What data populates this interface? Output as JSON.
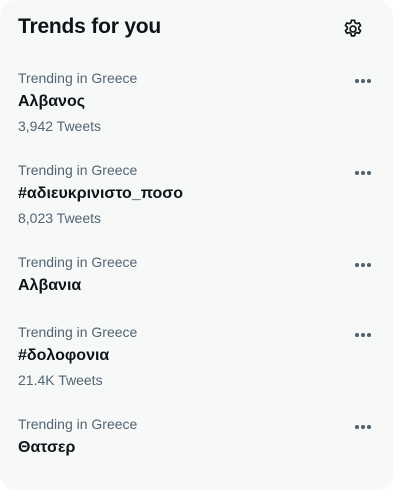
{
  "header": {
    "title": "Trends for you",
    "settings_icon": "gear-icon"
  },
  "trends": [
    {
      "context": "Trending in Greece",
      "name": "Αλβανος",
      "count": "3,942 Tweets",
      "more_icon": "more-horizontal-icon"
    },
    {
      "context": "Trending in Greece",
      "name": "#αδιευκρινιστο_ποσο",
      "count": "8,023 Tweets",
      "more_icon": "more-horizontal-icon"
    },
    {
      "context": "Trending in Greece",
      "name": "Αλβανια",
      "count": "",
      "more_icon": "more-horizontal-icon"
    },
    {
      "context": "Trending in Greece",
      "name": "#δολοφονια",
      "count": "21.4K Tweets",
      "more_icon": "more-horizontal-icon"
    },
    {
      "context": "Trending in Greece",
      "name": "Θατσερ",
      "count": "",
      "more_icon": "more-horizontal-icon"
    }
  ],
  "colors": {
    "panel_background": "#f7f9f9",
    "primary_text": "#0f1419",
    "secondary_text": "#536471"
  }
}
